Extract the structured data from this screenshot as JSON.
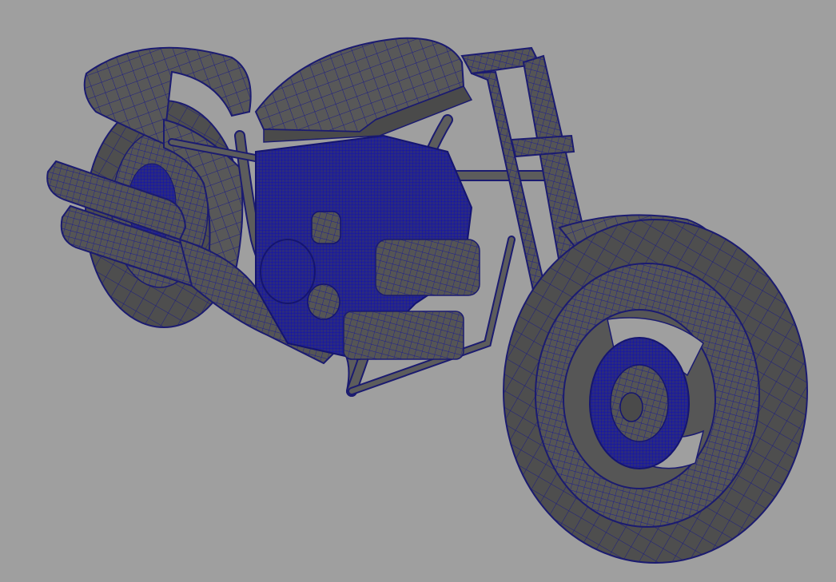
{
  "viewport": {
    "background_color": "#9f9f9f",
    "mesh_fill_color": "#5a5a5a",
    "mesh_shade_color": "#474747",
    "wireframe_color": "#1c1c8a",
    "wireframe_dense_color": "#1a1aa8"
  },
  "model": {
    "subject": "motorcycle",
    "display_mode": "shaded-with-wireframe",
    "components": [
      "rear-fender",
      "rear-wheel",
      "exhaust-pipes",
      "engine",
      "fuel-tank",
      "frame",
      "front-fork",
      "front-fender",
      "front-wheel",
      "brake-disc"
    ]
  }
}
